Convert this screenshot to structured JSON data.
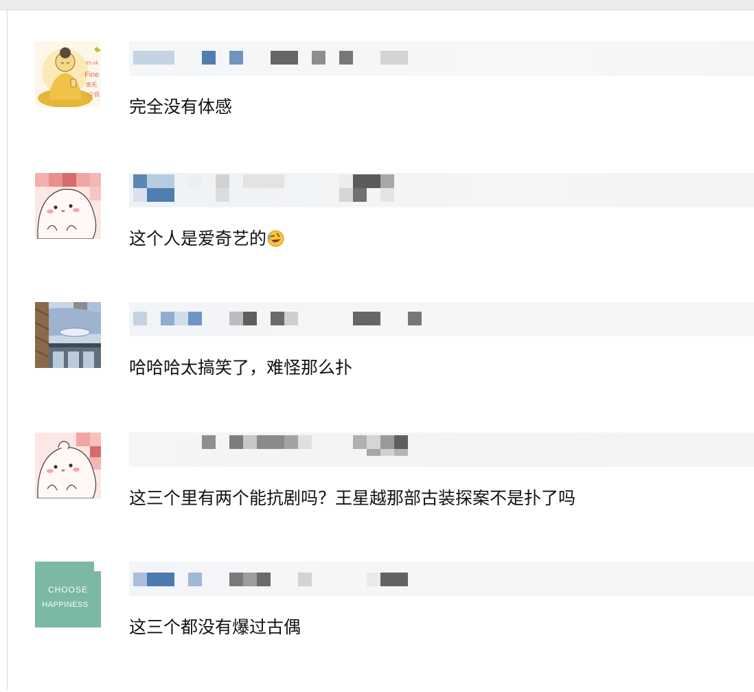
{
  "comments": [
    {
      "text": "完全没有体感",
      "avatar": "buddha-sticker-avatar",
      "avatar_caption": [
        "It's ok",
        "Fine",
        "南无",
        "少自"
      ]
    },
    {
      "text": "这个人是爱奇艺的",
      "emoji": "rolling-on-floor-laughing",
      "avatar": "pink-cartoon-avatar"
    },
    {
      "text": "哈哈哈太搞笑了，难怪那么扑",
      "avatar": "window-view-avatar"
    },
    {
      "text": "这三个里有两个能抗剧吗？王星越那部古装探案不是扑了吗",
      "avatar": "pink-cartoon-avatar"
    },
    {
      "text": "这三个都没有爆过古偶",
      "avatar": "teal-text-avatar",
      "avatar_caption": [
        "CHOOSE",
        "HAPPINESS"
      ]
    }
  ],
  "colors": {
    "page_bg": "#ffffff",
    "top_bar": "#ebebeb",
    "text": "#111111",
    "pixel_blue": "#5b86b5",
    "pixel_gray": "#6b6b6b",
    "teal_avatar": "#7bb9a2"
  }
}
